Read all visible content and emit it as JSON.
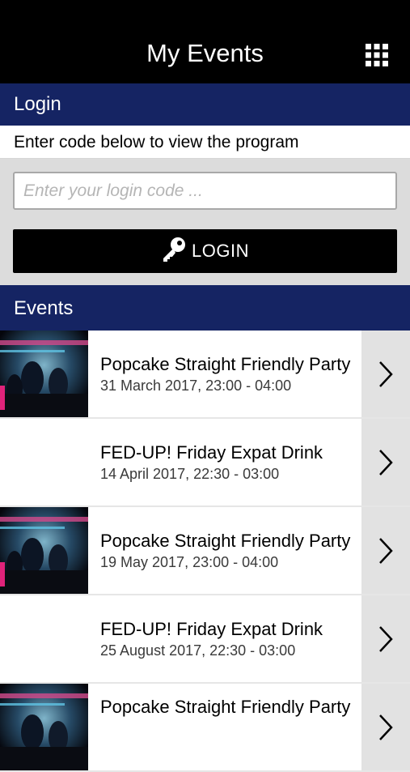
{
  "header": {
    "title": "My Events",
    "menu_icon": "grid-menu-icon"
  },
  "login": {
    "section_title": "Login",
    "instructions": "Enter code below to view the program",
    "input_placeholder": "Enter your login code ...",
    "input_value": "",
    "button_label": "LOGIN",
    "button_icon": "key-icon"
  },
  "events": {
    "section_title": "Events",
    "items": [
      {
        "title": "Popcake Straight Friendly Party",
        "date": "31 March 2017, 23:00 - 04:00",
        "has_thumbnail": true
      },
      {
        "title": "FED-UP! Friday Expat Drink",
        "date": "14 April 2017, 22:30 - 03:00",
        "has_thumbnail": false
      },
      {
        "title": "Popcake Straight Friendly Party",
        "date": "19 May 2017, 23:00 - 04:00",
        "has_thumbnail": true
      },
      {
        "title": "FED-UP! Friday Expat Drink",
        "date": "25 August 2017, 22:30 - 03:00",
        "has_thumbnail": false
      },
      {
        "title": "Popcake Straight Friendly Party",
        "date": "",
        "has_thumbnail": true
      }
    ]
  },
  "colors": {
    "topbar": "#000000",
    "section_header": "#152463",
    "login_panel": "#dcdcdc",
    "arrow_cell": "#e2e2e2"
  }
}
